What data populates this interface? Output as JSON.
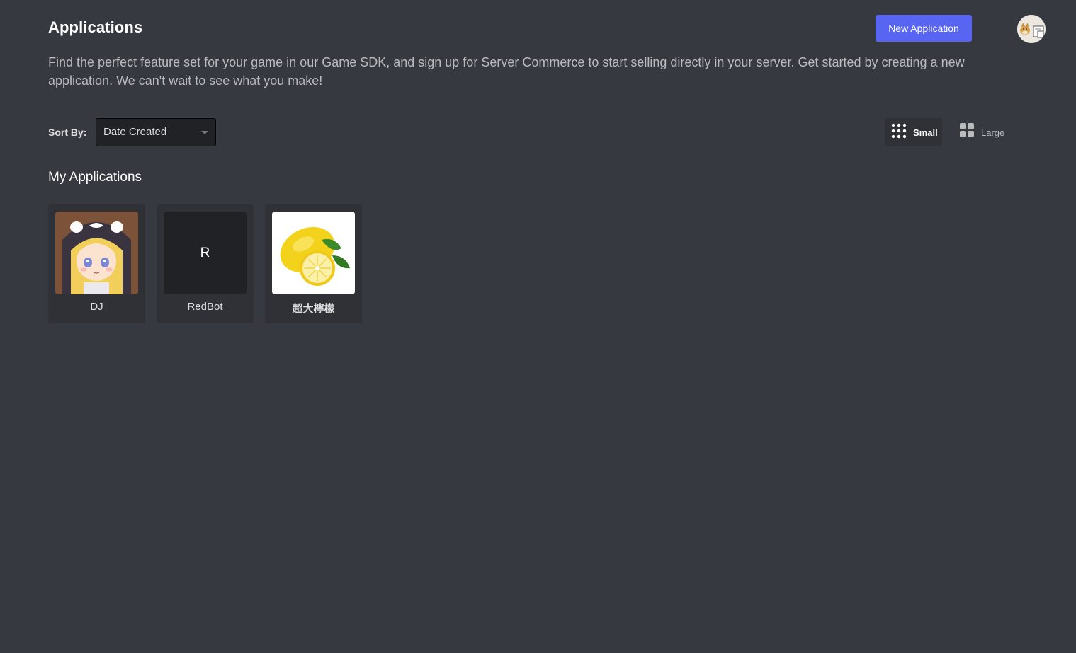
{
  "header": {
    "title": "Applications",
    "new_button_label": "New Application"
  },
  "description": "Find the perfect feature set for your game in our Game SDK, and sign up for Server Commerce to start selling directly in your server. Get started by creating a new application. We can't wait to see what you make!",
  "sort": {
    "label": "Sort By:",
    "selected": "Date Created"
  },
  "view": {
    "small_label": "Small",
    "large_label": "Large",
    "active": "Small"
  },
  "section_title": "My Applications",
  "apps": [
    {
      "name": "DJ",
      "icon": "anime-girl-avatar"
    },
    {
      "name": "RedBot",
      "icon_letter": "R"
    },
    {
      "name": "超大檸檬",
      "icon": "lemon-image"
    }
  ],
  "colors": {
    "background": "#36393f",
    "card": "#2f3136",
    "accent": "#5865f2"
  }
}
